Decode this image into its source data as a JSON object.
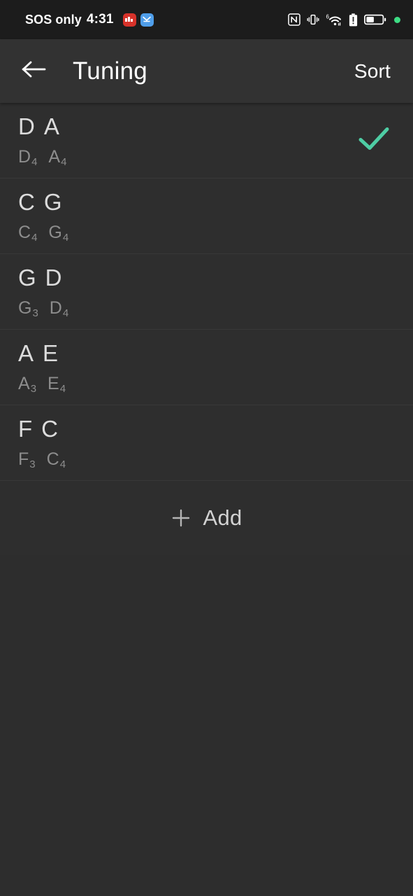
{
  "statusbar": {
    "carrier": "SOS only",
    "time": "4:31",
    "notifications": [
      {
        "name": "notification-badge-red",
        "color": "#d7322a",
        "label": ""
      },
      {
        "name": "notification-badge-blue",
        "color": "#4f9eea",
        "label": ""
      }
    ],
    "icons": [
      "nfc-icon",
      "vibrate-icon",
      "wifi-6-icon",
      "battery-alert-icon",
      "battery-icon",
      "privacy-indicator-dot"
    ],
    "wifi_generation": "6",
    "privacy_dot_color": "#3ddc84"
  },
  "appbar": {
    "back_icon": "back-arrow-icon",
    "title": "Tuning",
    "action_label": "Sort"
  },
  "colors": {
    "accent_check": "#4ecda4",
    "background": "#2d2d2d",
    "row_background": "#2e2e2e",
    "appbar_background": "#323232",
    "statusbar_background": "#1c1c1c",
    "divider": "#383838",
    "note_text": "#dcdcdc",
    "pitch_text": "#8d8d8d"
  },
  "list": {
    "rows": [
      {
        "notes": "D A",
        "note_1": "D",
        "note_2": "A",
        "pitch_1_letter": "D",
        "pitch_1_octave": "4",
        "pitch_2_letter": "A",
        "pitch_2_octave": "4",
        "selected": true
      },
      {
        "notes": "C G",
        "note_1": "C",
        "note_2": "G",
        "pitch_1_letter": "C",
        "pitch_1_octave": "4",
        "pitch_2_letter": "G",
        "pitch_2_octave": "4",
        "selected": false
      },
      {
        "notes": "G D",
        "note_1": "G",
        "note_2": "D",
        "pitch_1_letter": "G",
        "pitch_1_octave": "3",
        "pitch_2_letter": "D",
        "pitch_2_octave": "4",
        "selected": false
      },
      {
        "notes": "A E",
        "note_1": "A",
        "note_2": "E",
        "pitch_1_letter": "A",
        "pitch_1_octave": "3",
        "pitch_2_letter": "E",
        "pitch_2_octave": "4",
        "selected": false
      },
      {
        "notes": "F C",
        "note_1": "F",
        "note_2": "C",
        "pitch_1_letter": "F",
        "pitch_1_octave": "3",
        "pitch_2_letter": "C",
        "pitch_2_octave": "4",
        "selected": false
      }
    ]
  },
  "add": {
    "icon": "plus-icon",
    "label": "Add"
  }
}
